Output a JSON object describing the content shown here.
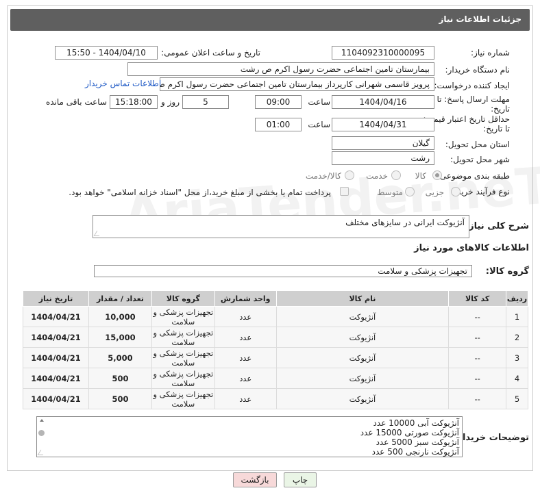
{
  "header": {
    "title": "جزئیات اطلاعات نیاز"
  },
  "fields": {
    "need_number_label": "شماره نیاز:",
    "need_number": "1104092310000095",
    "announce_label": "تاریخ و ساعت اعلان عمومی:",
    "announce_value": "1404/04/10 - 15:50",
    "buyer_org_label": "نام دستگاه خریدار:",
    "buyer_org": "بیمارستان  تامین اجتماعی حضرت رسول اکرم ص رشت",
    "creator_label": "ایجاد کننده درخواست:",
    "creator": "پرویز قاسمی شهرانی کارپرداز بیمارستان  تامین اجتماعی حضرت رسول اکرم ص",
    "contact_link": "اطلاعات تماس خریدار",
    "deadline_label_1": "مهلت ارسال پاسخ: تا",
    "deadline_label_2": "تاریخ:",
    "deadline_date": "1404/04/16",
    "time_label": "ساعت",
    "deadline_time": "09:00",
    "days_value": "5",
    "days_label": "روز و",
    "remaining_time": "15:18:00",
    "remaining_label": "ساعت باقی مانده",
    "price_label_1": "حداقل تاریخ اعتبار قیمت:",
    "price_label_2": "تا تاریخ:",
    "price_date": "1404/04/31",
    "price_time": "01:00",
    "province_label": "استان محل تحویل:",
    "province": "گیلان",
    "city_label": "شهر محل تحویل:",
    "city": "رشت",
    "category_label": "طبقه بندی موضوعی:",
    "category_options": [
      "کالا",
      "خدمت",
      "کالا/خدمت"
    ],
    "process_label": "نوع فرآیند خرید :",
    "process_options": [
      "جزیی",
      "متوسط"
    ],
    "payment_note": "پرداخت تمام یا بخشی از مبلغ خرید،از محل \"اسناد خزانه اسلامی\" خواهد بود."
  },
  "summary": {
    "label": "شرح کلی نیاز:",
    "value": "آنژیوکت ایرانی در سایزهای مختلف"
  },
  "goods_section": {
    "title": "اطلاعات کالاهای مورد نیاز",
    "group_label": "گروه کالا:",
    "group_value": "تجهیزات پزشکی و سلامت"
  },
  "table": {
    "headers": [
      "ردیف",
      "کد کالا",
      "نام کالا",
      "واحد شمارش",
      "گروه کالا",
      "تعداد / مقدار",
      "تاریخ نیاز"
    ],
    "rows": [
      {
        "row": "1",
        "code": "--",
        "name": "آنژیوکت",
        "unit": "عدد",
        "group": "تجهیزات پزشکی و سلامت",
        "qty": "10,000",
        "date": "1404/04/21"
      },
      {
        "row": "2",
        "code": "--",
        "name": "آنژیوکت",
        "unit": "عدد",
        "group": "تجهیزات پزشکی و سلامت",
        "qty": "15,000",
        "date": "1404/04/21"
      },
      {
        "row": "3",
        "code": "--",
        "name": "آنژیوکت",
        "unit": "عدد",
        "group": "تجهیزات پزشکی و سلامت",
        "qty": "5,000",
        "date": "1404/04/21"
      },
      {
        "row": "4",
        "code": "--",
        "name": "آنژیوکت",
        "unit": "عدد",
        "group": "تجهیزات پزشکی و سلامت",
        "qty": "500",
        "date": "1404/04/21"
      },
      {
        "row": "5",
        "code": "--",
        "name": "آنژیوکت",
        "unit": "عدد",
        "group": "تجهیزات پزشکی و سلامت",
        "qty": "500",
        "date": "1404/04/21"
      }
    ]
  },
  "notes": {
    "label": "توضیحات خریدار:",
    "lines": [
      "آنژیوکت آبی 10000 عدد",
      "آنژیوکت صورتی 15000 عدد",
      "آنژیوکت سبز 5000 عدد",
      "آنژیوکت نارنجی 500 عدد"
    ]
  },
  "buttons": {
    "print": "چاپ",
    "back": "بازگشت"
  },
  "watermark": "AriaTender.neT"
}
